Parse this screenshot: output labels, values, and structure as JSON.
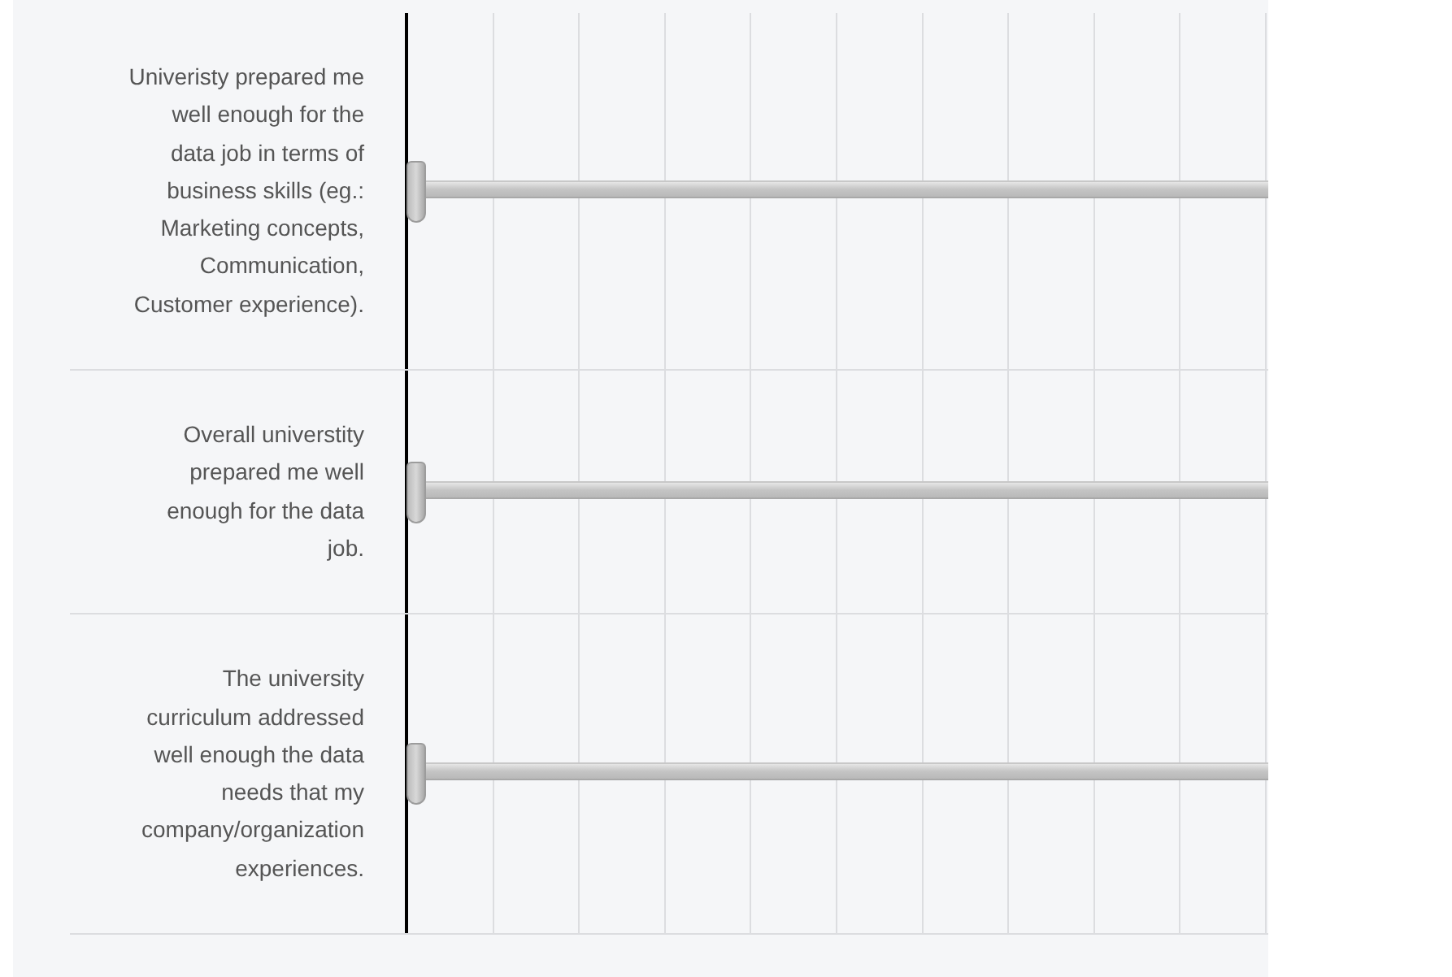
{
  "statements": [
    {
      "text": "Univeristy prepared me well enough for the data job in terms of business skills (eg.: Marketing concepts, Communication, Customer experience).",
      "slider": {
        "level": 0
      }
    },
    {
      "text": "Overall universtity prepared me well enough for the data job.",
      "slider": {
        "level": 0
      }
    },
    {
      "text": "The university curriculum addressed well enough the data needs that my company/organization experiences.",
      "slider": {
        "level": 0
      }
    }
  ]
}
